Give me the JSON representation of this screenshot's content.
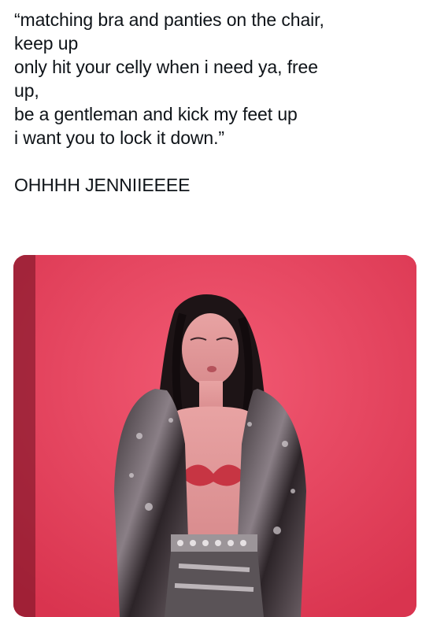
{
  "tweet": {
    "lines": [
      "“matching bra and panties on the chair,",
      "keep up",
      "only hit your celly when i need ya, free",
      "up,",
      "be a gentleman and kick my feet up",
      "i want you to lock it down.”"
    ],
    "comment": "OHHHH JENNIIEEEE"
  },
  "media": {
    "kind": "photo",
    "background_color": "#e63f5f"
  }
}
